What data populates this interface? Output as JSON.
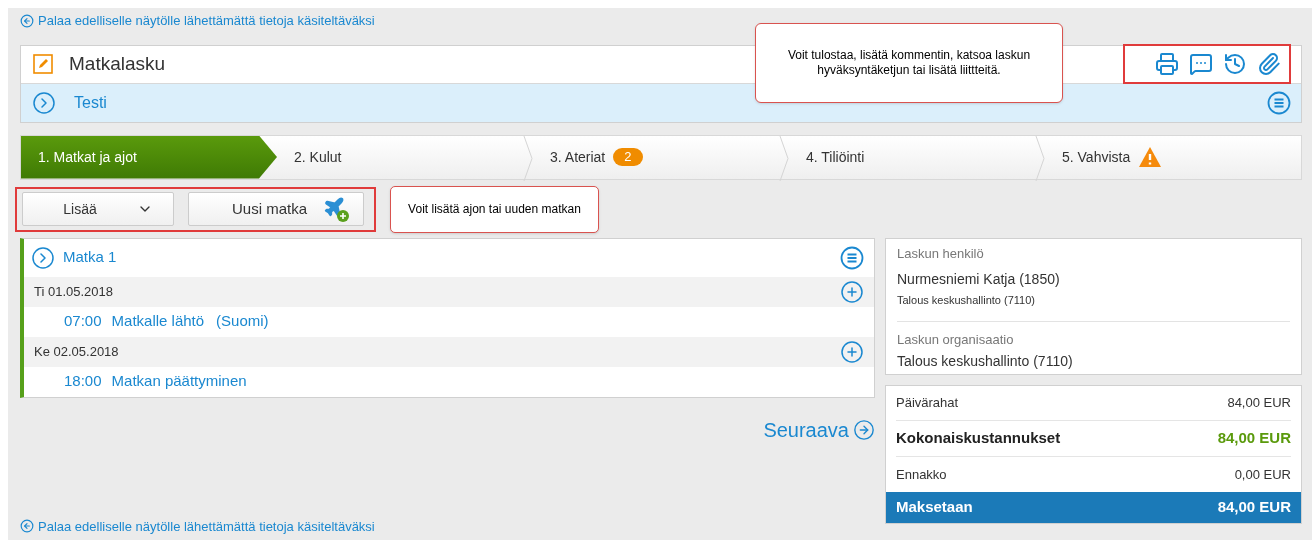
{
  "back_link_top": "Palaa edelliselle näytölle lähettämättä tietoja käsiteltäväksi",
  "header": {
    "title": "Matkalasku",
    "subtitle": "Testi"
  },
  "callouts": [
    {
      "text": "Voit tulostaa, lisätä kommentin, katsoa laskun hyväksyntäketjun tai lisätä liittteitä."
    },
    {
      "text": "Voit lisätä ajon tai uuden matkan"
    }
  ],
  "steps": [
    {
      "label": "1. Matkat ja ajot",
      "selected": true,
      "alert": false
    },
    {
      "label": "2. Kulut",
      "selected": false,
      "alert": false
    },
    {
      "label": "3. Ateriat",
      "selected": false,
      "alert": false,
      "badge": "2"
    },
    {
      "label": "4. Tiliöinti",
      "selected": false,
      "alert": false
    },
    {
      "label": "5. Vahvista",
      "selected": false,
      "alert": true
    }
  ],
  "toolbar": {
    "add_menu": "Lisää",
    "new_trip": "Uusi matka"
  },
  "trip": {
    "title": "Matka 1",
    "days": [
      {
        "date": "Ti 01.05.2018",
        "events": [
          {
            "time": "07:00",
            "label": "Matkalle lähtö",
            "country": "(Suomi)"
          }
        ]
      },
      {
        "date": "Ke 02.05.2018",
        "events": [
          {
            "time": "18:00",
            "label": "Matkan päättyminen"
          }
        ]
      }
    ]
  },
  "next": "Seuraava",
  "person": {
    "label": "Laskun henkilö",
    "name": "Nurmesniemi Katja (1850)",
    "unit": "Talous keskushallinto (7110)"
  },
  "organisation": {
    "label": "Laskun organisaatio",
    "value": "Talous keskushallinto (7110)"
  },
  "summary": [
    {
      "kind": "normal",
      "label": "Päivärahat",
      "amount": "84,00 EUR"
    },
    {
      "kind": "total",
      "label": "Kokonaiskustannukset",
      "amount": "84,00 EUR"
    },
    {
      "kind": "normal",
      "label": "Ennakko",
      "amount": "0,00 EUR"
    },
    {
      "kind": "payable",
      "label": "Maksetaan",
      "amount": "84,00 EUR"
    }
  ],
  "back_link_bottom": "Palaa edelliselle näytölle lähettämättä tietoja käsiteltäväksi"
}
